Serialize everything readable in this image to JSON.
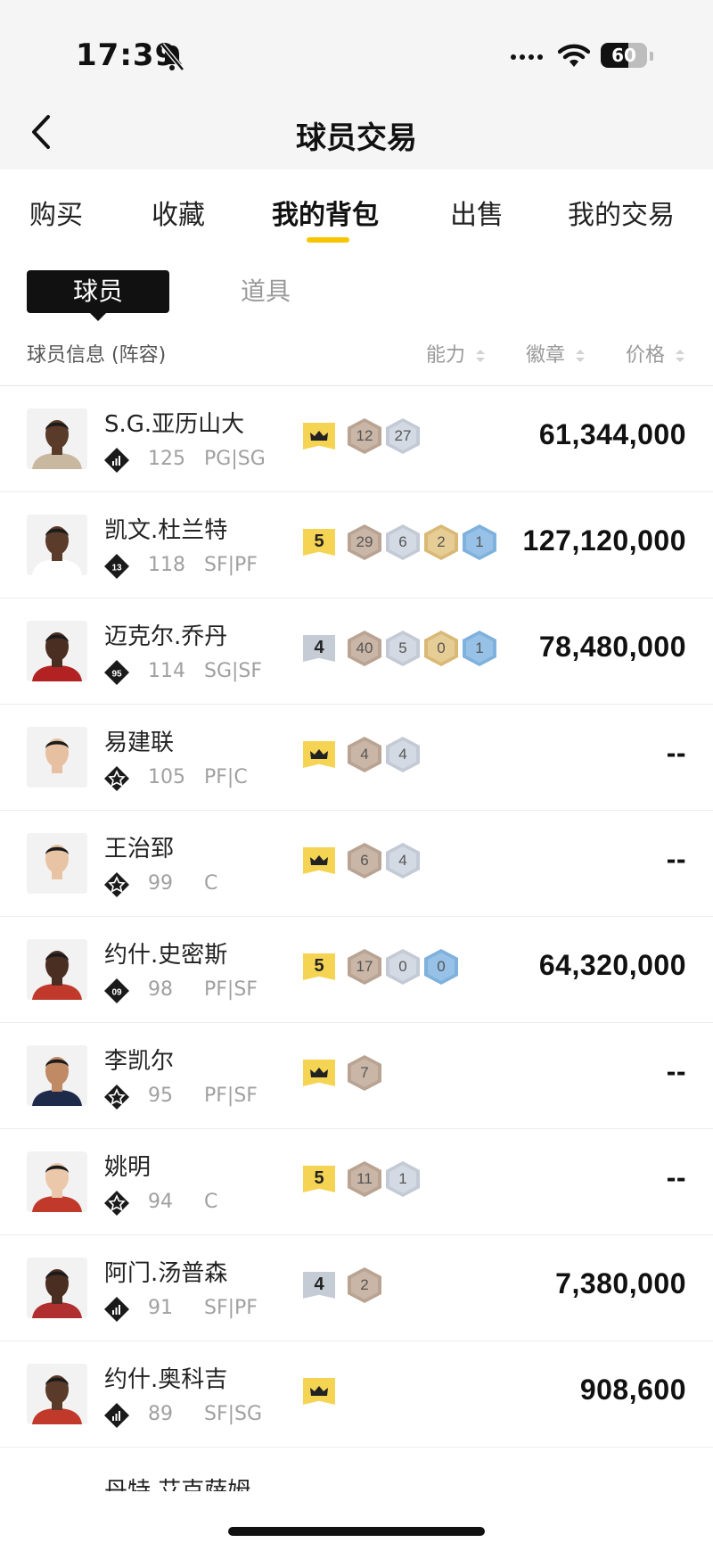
{
  "status": {
    "time": "17:39",
    "battery": 60
  },
  "nav": {
    "title": "球员交易"
  },
  "tabs": [
    "购买",
    "收藏",
    "我的背包",
    "出售",
    "我的交易"
  ],
  "active_tab": "我的背包",
  "segments": {
    "active": "球员",
    "other": "道具"
  },
  "columns": {
    "info": "球员信息 (阵容)",
    "ability": "能力",
    "badge": "徽章",
    "price": "价格"
  },
  "players": [
    {
      "name": "S.G.亚历山大",
      "ovr": "125",
      "pos": "PG|SG",
      "level": "crown",
      "badges": [
        {
          "v": "12",
          "c": "bronze"
        },
        {
          "v": "27",
          "c": "silver"
        }
      ],
      "price": "61,344,000",
      "tier": "bars",
      "skin": "#5a3a28",
      "jersey": "#c9b8a0"
    },
    {
      "name": "凯文.杜兰特",
      "ovr": "118",
      "pos": "SF|PF",
      "level": "5",
      "badges": [
        {
          "v": "29",
          "c": "bronze"
        },
        {
          "v": "6",
          "c": "silver"
        },
        {
          "v": "2",
          "c": "gold"
        },
        {
          "v": "1",
          "c": "blue"
        }
      ],
      "price": "127,120,000",
      "tier": "13",
      "skin": "#5b3b2a",
      "jersey": "#ffffff"
    },
    {
      "name": "迈克尔.乔丹",
      "ovr": "114",
      "pos": "SG|SF",
      "level": "4",
      "badges": [
        {
          "v": "40",
          "c": "bronze"
        },
        {
          "v": "5",
          "c": "silver"
        },
        {
          "v": "0",
          "c": "gold"
        },
        {
          "v": "1",
          "c": "blue"
        }
      ],
      "price": "78,480,000",
      "tier": "95",
      "skin": "#4a2e22",
      "jersey": "#b22222"
    },
    {
      "name": "易建联",
      "ovr": "105",
      "pos": "PF|C",
      "level": "crown",
      "badges": [
        {
          "v": "4",
          "c": "bronze"
        },
        {
          "v": "4",
          "c": "silver"
        }
      ],
      "price": "--",
      "tier": "star",
      "skin": "#e6c0a0",
      "jersey": "#f2f2f2"
    },
    {
      "name": "王治郅",
      "ovr": "99",
      "pos": "C",
      "level": "crown",
      "badges": [
        {
          "v": "6",
          "c": "bronze"
        },
        {
          "v": "4",
          "c": "silver"
        }
      ],
      "price": "--",
      "tier": "star",
      "skin": "#e8c4a4",
      "jersey": "#f2f2f2"
    },
    {
      "name": "约什.史密斯",
      "ovr": "98",
      "pos": "PF|SF",
      "level": "5",
      "badges": [
        {
          "v": "17",
          "c": "bronze"
        },
        {
          "v": "0",
          "c": "silver"
        },
        {
          "v": "0",
          "c": "blue"
        }
      ],
      "price": "64,320,000",
      "tier": "09",
      "skin": "#4a2e22",
      "jersey": "#c0392b"
    },
    {
      "name": "李凯尔",
      "ovr": "95",
      "pos": "PF|SF",
      "level": "crown",
      "badges": [
        {
          "v": "7",
          "c": "bronze"
        }
      ],
      "price": "--",
      "tier": "star",
      "skin": "#c08a65",
      "jersey": "#1e2a4a"
    },
    {
      "name": "姚明",
      "ovr": "94",
      "pos": "C",
      "level": "5",
      "badges": [
        {
          "v": "11",
          "c": "bronze"
        },
        {
          "v": "1",
          "c": "silver"
        }
      ],
      "price": "--",
      "tier": "star",
      "skin": "#ecc8aa",
      "jersey": "#c0392b"
    },
    {
      "name": "阿门.汤普森",
      "ovr": "91",
      "pos": "SF|PF",
      "level": "4",
      "badges": [
        {
          "v": "2",
          "c": "bronze"
        }
      ],
      "price": "7,380,000",
      "tier": "bars",
      "skin": "#4a2e22",
      "jersey": "#b03030"
    },
    {
      "name": "约什.奥科吉",
      "ovr": "89",
      "pos": "SF|SG",
      "level": "crown",
      "badges": [],
      "price": "908,600",
      "tier": "bars",
      "skin": "#5a3a28",
      "jersey": "#c0392b"
    }
  ],
  "partial_row": {
    "name": "丹特.艾克萨姆"
  },
  "colors": {
    "accent": "#f7c600",
    "bronze": "#b9a392",
    "silver": "#c3cad6",
    "gold": "#d9b976",
    "blue": "#7eb1dc"
  }
}
